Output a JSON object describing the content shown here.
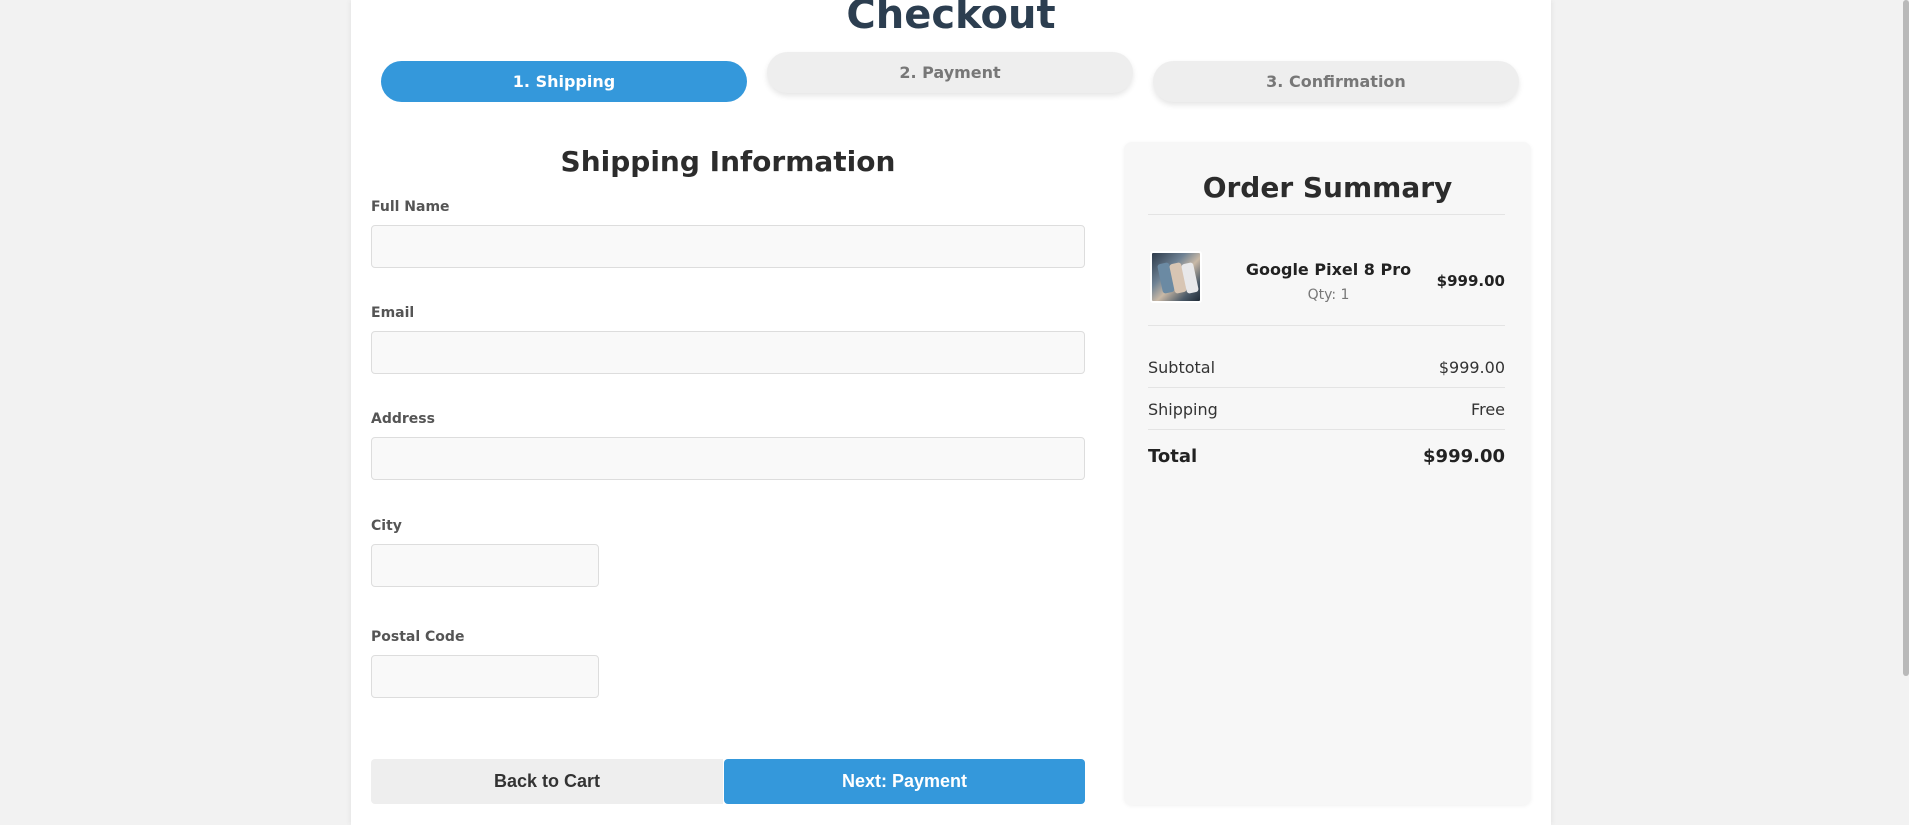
{
  "page": {
    "title": "Checkout"
  },
  "steps": [
    {
      "label": "1. Shipping",
      "active": true
    },
    {
      "label": "2. Payment",
      "active": false
    },
    {
      "label": "3. Confirmation",
      "active": false
    }
  ],
  "shipping": {
    "title": "Shipping Information",
    "fields": {
      "full_name": {
        "label": "Full Name",
        "value": ""
      },
      "email": {
        "label": "Email",
        "value": ""
      },
      "address": {
        "label": "Address",
        "value": ""
      },
      "city": {
        "label": "City",
        "value": ""
      },
      "postal_code": {
        "label": "Postal Code",
        "value": ""
      }
    },
    "back_label": "Back to Cart",
    "next_label": "Next: Payment"
  },
  "summary": {
    "title": "Order Summary",
    "item": {
      "name": "Google Pixel 8 Pro",
      "qty": "Qty: 1",
      "price": "$999.00"
    },
    "subtotal_label": "Subtotal",
    "subtotal_value": "$999.00",
    "shipping_label": "Shipping",
    "shipping_value": "Free",
    "total_label": "Total",
    "total_value": "$999.00"
  },
  "colors": {
    "accent": "#3498db",
    "title": "#2c3e50",
    "inactive_step": "#eeeeee"
  }
}
